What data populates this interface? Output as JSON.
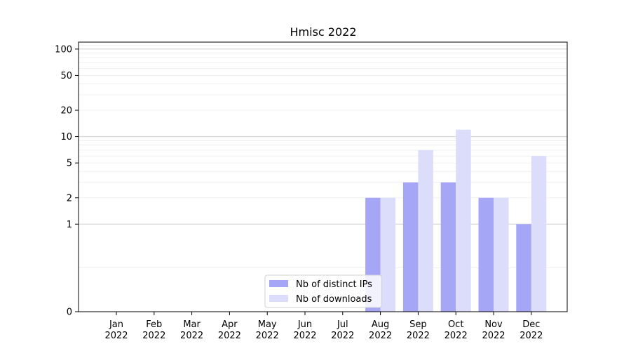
{
  "chart_data": {
    "type": "bar",
    "title": "Hmisc 2022",
    "xlabel": "",
    "ylabel": "",
    "yscale": "symlog",
    "ylim": [
      0,
      120
    ],
    "yticks": [
      0,
      1,
      2,
      5,
      10,
      20,
      50,
      100
    ],
    "grid": "horizontal",
    "legend_position": "bottom-center",
    "categories": [
      [
        "Jan",
        "2022"
      ],
      [
        "Feb",
        "2022"
      ],
      [
        "Mar",
        "2022"
      ],
      [
        "Apr",
        "2022"
      ],
      [
        "May",
        "2022"
      ],
      [
        "Jun",
        "2022"
      ],
      [
        "Jul",
        "2022"
      ],
      [
        "Aug",
        "2022"
      ],
      [
        "Sep",
        "2022"
      ],
      [
        "Oct",
        "2022"
      ],
      [
        "Nov",
        "2022"
      ],
      [
        "Dec",
        "2022"
      ]
    ],
    "series": [
      {
        "name": "Nb of distinct IPs",
        "color": "#a6a6f7",
        "values": [
          0,
          0,
          0,
          0,
          0,
          0,
          0,
          2,
          3,
          3,
          2,
          1
        ]
      },
      {
        "name": "Nb of downloads",
        "color": "#dcdcfb",
        "values": [
          0,
          0,
          0,
          0,
          0,
          0,
          0,
          2,
          7,
          12,
          2,
          6
        ]
      }
    ]
  }
}
